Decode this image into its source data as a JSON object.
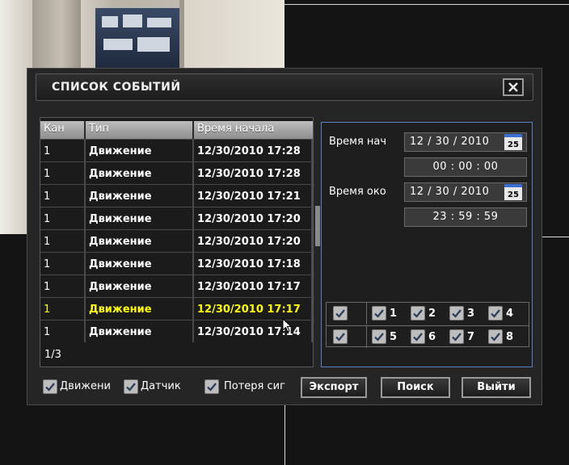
{
  "dialog": {
    "title": "СПИСОК СОБЫТИЙ",
    "close_icon": "close-icon"
  },
  "table": {
    "headers": [
      "Кан",
      "Тип",
      "Время начала"
    ],
    "rows": [
      {
        "ch": "1",
        "type": "Движение",
        "time": "12/30/2010 17:28"
      },
      {
        "ch": "1",
        "type": "Движение",
        "time": "12/30/2010 17:28"
      },
      {
        "ch": "1",
        "type": "Движение",
        "time": "12/30/2010 17:21"
      },
      {
        "ch": "1",
        "type": "Движение",
        "time": "12/30/2010 17:20"
      },
      {
        "ch": "1",
        "type": "Движение",
        "time": "12/30/2010 17:20"
      },
      {
        "ch": "1",
        "type": "Движение",
        "time": "12/30/2010 17:18"
      },
      {
        "ch": "1",
        "type": "Движение",
        "time": "12/30/2010 17:17"
      },
      {
        "ch": "1",
        "type": "Движение",
        "time": "12/30/2010 17:17"
      },
      {
        "ch": "1",
        "type": "Движение",
        "time": "12/30/2010 17:14"
      }
    ],
    "selected_row": 7,
    "pager": "1/3"
  },
  "search": {
    "start_label": "Время нач",
    "start_date": "12 / 30 / 2010",
    "start_time": "00  :  00  :  00",
    "end_label": "Время око",
    "end_date": "12 / 30 / 2010",
    "end_time": "23  :  59  :  59",
    "calendar_icon_text": "25",
    "channels_row1": [
      "1",
      "2",
      "3",
      "4"
    ],
    "channels_row2": [
      "5",
      "6",
      "7",
      "8"
    ]
  },
  "filters": {
    "motion": "Движени",
    "sensor": "Датчик",
    "signal_loss": "Потеря сиг"
  },
  "buttons": {
    "export": "Экспорт",
    "search": "Поиск",
    "exit": "Выйти"
  },
  "colors": {
    "selected_row_text": "#ffff00",
    "panel_border": "#5a80c8"
  }
}
